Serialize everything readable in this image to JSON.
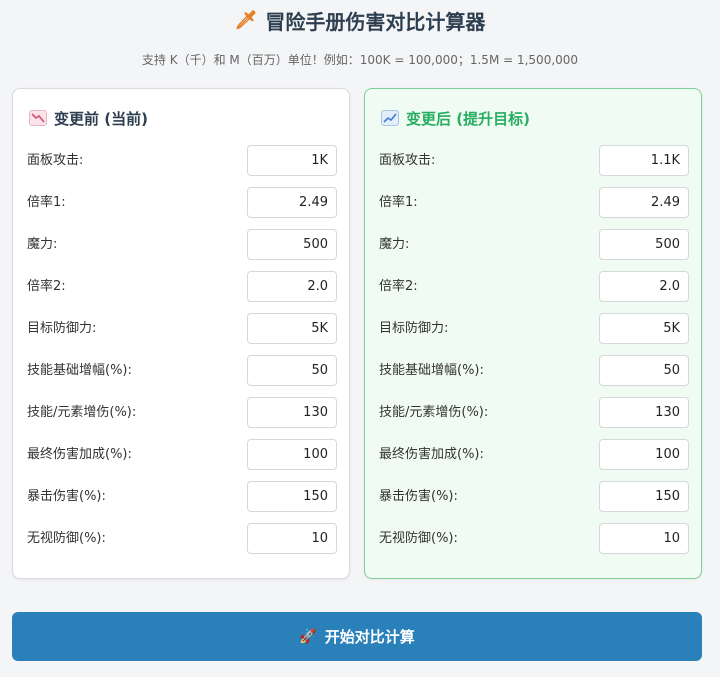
{
  "header": {
    "title_icon": "🗡",
    "title": "冒险手册伤害对比计算器",
    "subtitle": "支持 K（千）和 M（百万）单位！例如：100K = 100,000；1.5M = 1,500,000"
  },
  "before": {
    "title": "变更前 (当前)",
    "icon": "chart-decreasing-icon",
    "fields": [
      {
        "label": "面板攻击:",
        "value": "1K"
      },
      {
        "label": "倍率1:",
        "value": "2.49"
      },
      {
        "label": "魔力:",
        "value": "500"
      },
      {
        "label": "倍率2:",
        "value": "2.0"
      },
      {
        "label": "目标防御力:",
        "value": "5K"
      },
      {
        "label": "技能基础增幅(%):",
        "value": "50"
      },
      {
        "label": "技能/元素增伤(%):",
        "value": "130"
      },
      {
        "label": "最终伤害加成(%):",
        "value": "100"
      },
      {
        "label": "暴击伤害(%):",
        "value": "150"
      },
      {
        "label": "无视防御(%):",
        "value": "10"
      }
    ]
  },
  "after": {
    "title": "变更后 (提升目标)",
    "icon": "chart-increasing-icon",
    "fields": [
      {
        "label": "面板攻击:",
        "value": "1.1K"
      },
      {
        "label": "倍率1:",
        "value": "2.49"
      },
      {
        "label": "魔力:",
        "value": "500"
      },
      {
        "label": "倍率2:",
        "value": "2.0"
      },
      {
        "label": "目标防御力:",
        "value": "5K"
      },
      {
        "label": "技能基础增幅(%):",
        "value": "50"
      },
      {
        "label": "技能/元素增伤(%):",
        "value": "130"
      },
      {
        "label": "最终伤害加成(%):",
        "value": "100"
      },
      {
        "label": "暴击伤害(%):",
        "value": "150"
      },
      {
        "label": "无视防御(%):",
        "value": "10"
      }
    ]
  },
  "action": {
    "label": "开始对比计算",
    "icon": "🚀"
  },
  "colors": {
    "primary_button": "#2a80b9",
    "after_accent": "#27ae60",
    "after_border": "#7fcf97",
    "after_background": "#f0fbf3"
  }
}
